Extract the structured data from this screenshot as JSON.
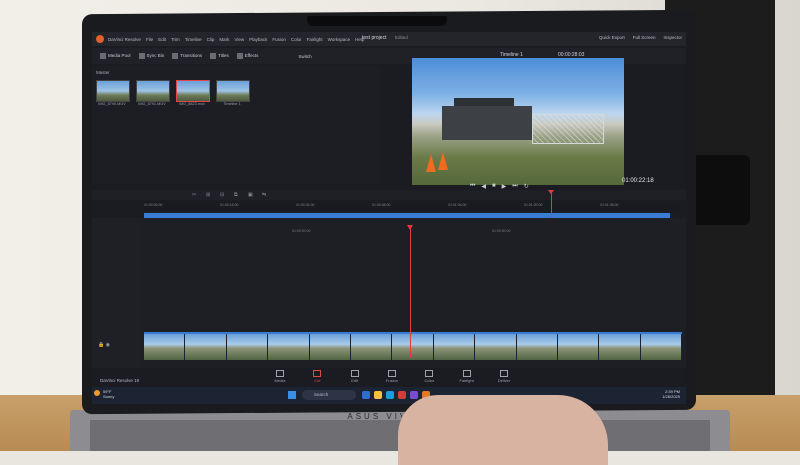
{
  "app": {
    "name": "DaVinci Resolve",
    "menu": [
      "DaVinci Resolve",
      "File",
      "Edit",
      "Trim",
      "Timeline",
      "Clip",
      "Mark",
      "View",
      "Playback",
      "Fusion",
      "Color",
      "Fairlight",
      "Workspace",
      "Help"
    ],
    "project_title": "test project",
    "project_state": "Edited",
    "top_right": [
      "Quick Export",
      "Full Screen",
      "Inspector"
    ]
  },
  "toolbar": {
    "media_pool": "Media Pool",
    "sync_bin": "Sync Bin",
    "transitions": "Transitions",
    "titles": "Titles",
    "effects": "Effects",
    "switch": "Switch",
    "timeline_name": "Timeline 1",
    "top_timecode": "00:00:28:03"
  },
  "media_pool": {
    "bin_label": "Master",
    "clips": [
      {
        "label": "IMG_8790.MOV"
      },
      {
        "label": "IMG_8791.MOV"
      },
      {
        "label": "IMG_8823.mov"
      },
      {
        "label": "Timeline 1"
      }
    ]
  },
  "viewer": {
    "timecode": "01:00:22:18"
  },
  "timeline": {
    "mini_ticks": [
      "01:00:00:00",
      "01:00:16:00",
      "01:00:32:00",
      "01:00:48:00",
      "01:01:04:00",
      "01:01:20:00",
      "01:01:36:00"
    ],
    "zoom_ticks": [
      "01:00:20:00",
      "01:00:30:00"
    ]
  },
  "pages": [
    {
      "label": "Media",
      "active": false
    },
    {
      "label": "Cut",
      "active": true
    },
    {
      "label": "Edit",
      "active": false
    },
    {
      "label": "Fusion",
      "active": false
    },
    {
      "label": "Color",
      "active": false
    },
    {
      "label": "Fairlight",
      "active": false
    },
    {
      "label": "Deliver",
      "active": false
    }
  ],
  "branding": {
    "resolve_label": "DaVinci Resolve 19",
    "laptop_label": "ASUS VIVOBOOK"
  },
  "taskbar": {
    "weather_temp": "59°F",
    "weather_desc": "Sunny",
    "search": "Search",
    "clock_time": "2:39 PM",
    "clock_date": "1/28/2025"
  },
  "colors": {
    "accent": "#e04848",
    "timeline_blue": "#3a7bd5",
    "ui_background": "#1b1c22"
  }
}
